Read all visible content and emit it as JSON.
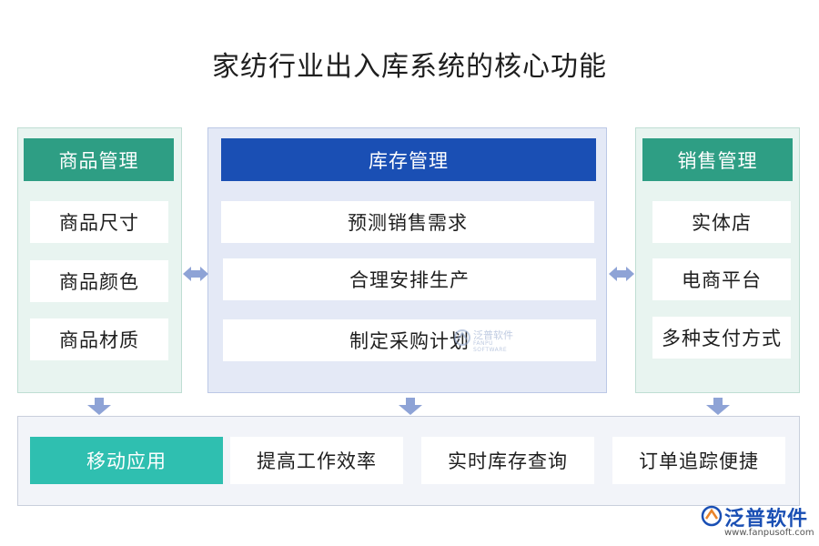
{
  "title": "家纺行业出入库系统的核心功能",
  "left": {
    "header": "商品管理",
    "items": [
      "商品尺寸",
      "商品颜色",
      "商品材质"
    ]
  },
  "middle": {
    "header": "库存管理",
    "items": [
      "预测销售需求",
      "合理安排生产",
      "制定采购计划"
    ]
  },
  "right": {
    "header": "销售管理",
    "items": [
      "实体店",
      "电商平台",
      "多种支付方式"
    ]
  },
  "bottom": {
    "header": "移动应用",
    "items": [
      "提高工作效率",
      "实时库存查询",
      "订单追踪便捷"
    ]
  },
  "watermark": {
    "cn": "泛普软件",
    "en": "FANPU SOFTWARE"
  },
  "logo": {
    "name": "泛普软件",
    "url": "www.fanpusoft.com"
  },
  "colors": {
    "green_header": "#2e9e84",
    "blue_header": "#1a4fb4",
    "teal_header": "#2fbfb0",
    "arrow": "#8ea3d6"
  }
}
